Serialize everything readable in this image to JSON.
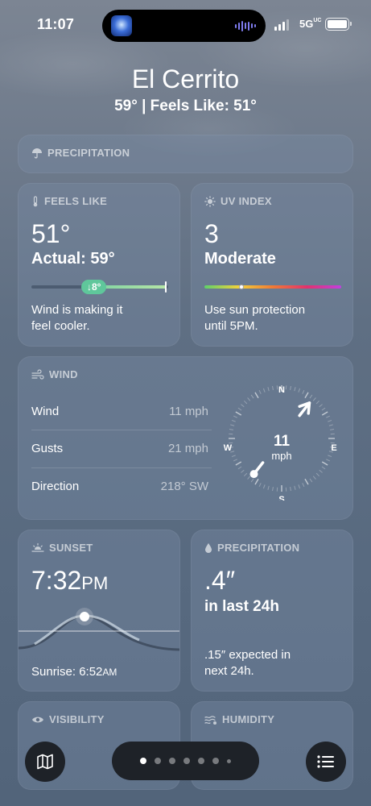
{
  "status_bar": {
    "time": "11:07",
    "network": "5G",
    "network_sub": "UC"
  },
  "header": {
    "city": "El Cerrito",
    "summary": "59°  |  Feels Like: 51°"
  },
  "precipitation_top": {
    "title": "PRECIPITATION"
  },
  "feels_like": {
    "title": "FEELS LIKE",
    "value": "51°",
    "actual": "Actual: 59°",
    "bar_badge": "↓8°",
    "description_line1": "Wind is making it",
    "description_line2": "feel cooler."
  },
  "uv_index": {
    "title": "UV INDEX",
    "value": "3",
    "level": "Moderate",
    "level_fraction": 0.27,
    "description_line1": "Use sun protection",
    "description_line2": "until 5PM."
  },
  "wind": {
    "title": "WIND",
    "rows": [
      {
        "label": "Wind",
        "value": "11 mph"
      },
      {
        "label": "Gusts",
        "value": "21 mph"
      },
      {
        "label": "Direction",
        "value": "218° SW"
      }
    ],
    "compass": {
      "speed": "11",
      "unit": "mph",
      "n": "N",
      "e": "E",
      "s": "S",
      "w": "W",
      "direction_degrees": 218
    }
  },
  "sunset": {
    "title": "SUNSET",
    "time": "7:32",
    "time_suffix": "PM",
    "sunrise": "Sunrise: 6:52",
    "sunrise_suffix": "AM"
  },
  "precipitation": {
    "title": "PRECIPITATION",
    "value": ".4″",
    "period": "in last 24h",
    "description_line1": ".15″ expected in",
    "description_line2": "next 24h."
  },
  "visibility": {
    "title": "VISIBILITY"
  },
  "humidity": {
    "title": "HUMIDITY"
  },
  "bottom_bar": {
    "page_count": 7,
    "active_page": 1
  },
  "colors": {
    "card_bg": "#7c8ca5",
    "feels_bar": "#8fd8a8",
    "uv_gradient": [
      "#5fd16a",
      "#f2d23b",
      "#f07a34",
      "#e3316e",
      "#c13fe0"
    ]
  }
}
